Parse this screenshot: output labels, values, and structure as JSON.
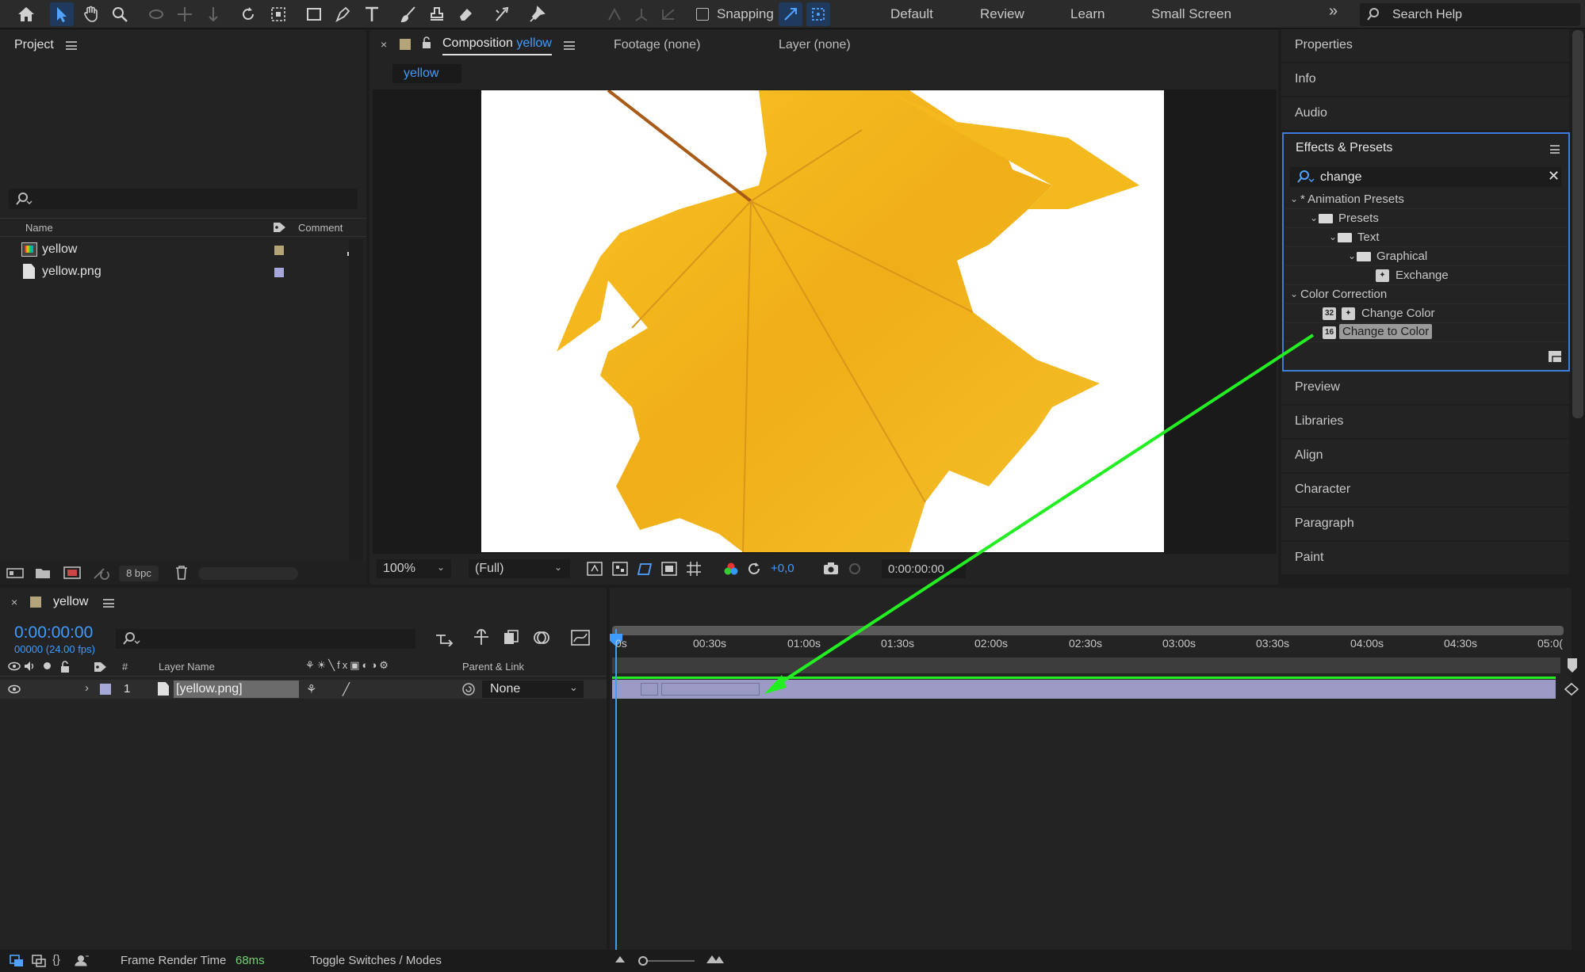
{
  "toolbar": {
    "snapping_label": "Snapping",
    "workspaces": [
      "Default",
      "Review",
      "Learn",
      "Small Screen"
    ],
    "overflow_label": "»",
    "search_help_placeholder": "Search Help"
  },
  "project": {
    "title": "Project",
    "search_value": "",
    "col_name": "Name",
    "col_comment": "Comment",
    "items": [
      {
        "name": "yellow",
        "label_color": "#b5a47a",
        "icon": "composition-icon"
      },
      {
        "name": "yellow.png",
        "label_color": "#a6a8d8",
        "icon": "file-icon"
      }
    ],
    "bpc_label": "8 bpc"
  },
  "composition": {
    "tab_prefix": "Composition",
    "tab_name": "yellow",
    "footage_tab": "Footage (none)",
    "layer_tab": "Layer (none)",
    "sub_tab": "yellow",
    "zoom": "100%",
    "resolution": "(Full)",
    "exposure": "+0,0",
    "timecode": "0:00:00:00"
  },
  "right_panels": {
    "top": [
      "Properties",
      "Info",
      "Audio"
    ],
    "bottom": [
      "Preview",
      "Libraries",
      "Align",
      "Character",
      "Paragraph",
      "Paint"
    ]
  },
  "effects": {
    "title": "Effects & Presets",
    "search_value": "change",
    "tree": [
      {
        "label": "* Animation Presets",
        "indent": 0,
        "type": "group"
      },
      {
        "label": "Presets",
        "indent": 1,
        "type": "folder"
      },
      {
        "label": "Text",
        "indent": 2,
        "type": "folder"
      },
      {
        "label": "Graphical",
        "indent": 3,
        "type": "folder"
      },
      {
        "label": "Exchange",
        "indent": 4,
        "type": "preset"
      },
      {
        "label": "Color Correction",
        "indent": 0,
        "type": "group"
      },
      {
        "label": "Change Color",
        "indent": 2,
        "type": "effect",
        "badge": "32"
      },
      {
        "label": "Change to Color",
        "indent": 2,
        "type": "effect-selected",
        "badge": "16"
      }
    ]
  },
  "timeline": {
    "comp_name": "yellow",
    "timecode": "0:00:00:00",
    "frames": "00000 (24.00 fps)",
    "col_num": "#",
    "col_layer_name": "Layer Name",
    "col_parent": "Parent & Link",
    "ruler": [
      "0s",
      "00:30s",
      "01:00s",
      "01:30s",
      "02:00s",
      "02:30s",
      "03:00s",
      "03:30s",
      "04:00s",
      "04:30s",
      "05:0("
    ],
    "layer": {
      "index": "1",
      "name": "[yellow.png]",
      "parent": "None",
      "label_color": "#a6a8d8"
    }
  },
  "status": {
    "render_label": "Frame Render Time",
    "render_value": "68ms",
    "toggle_label": "Toggle Switches / Modes"
  },
  "colors": {
    "accent_blue": "#3f9bff",
    "arrow_green": "#22ee22",
    "leaf": "#f2b51d",
    "bar_lavender": "#9a9ac4"
  }
}
